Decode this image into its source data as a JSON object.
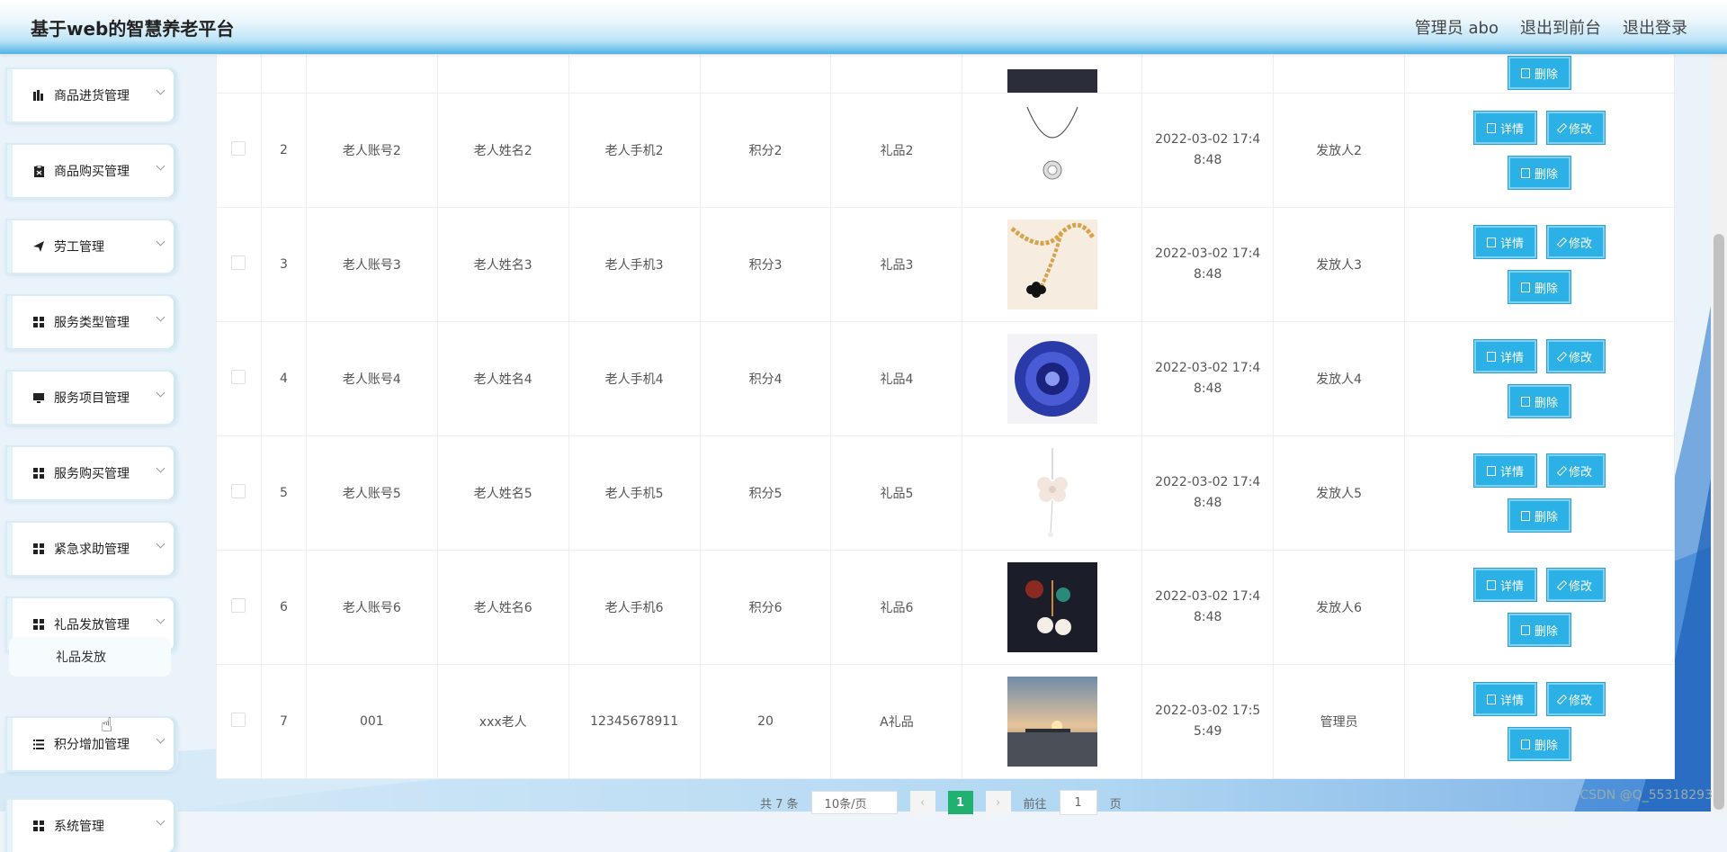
{
  "header": {
    "title": "基于web的智慧养老平台",
    "links": [
      "管理员 abo",
      "退出到前台",
      "退出登录"
    ]
  },
  "sidebar": {
    "items": [
      {
        "label": "商品进货管理",
        "icon": "bar-chart-icon"
      },
      {
        "label": "商品购买管理",
        "icon": "clipboard-icon"
      },
      {
        "label": "劳工管理",
        "icon": "send-icon"
      },
      {
        "label": "服务类型管理",
        "icon": "grid-icon"
      },
      {
        "label": "服务项目管理",
        "icon": "monitor-icon"
      },
      {
        "label": "服务购买管理",
        "icon": "grid-icon"
      },
      {
        "label": "紧急求助管理",
        "icon": "grid-icon"
      },
      {
        "label": "礼品发放管理",
        "icon": "grid-icon"
      },
      {
        "label": "积分增加管理",
        "icon": "list-icon"
      },
      {
        "label": "系统管理",
        "icon": "grid-icon"
      }
    ],
    "sub_item": "礼品发放"
  },
  "table": {
    "top_partial_button": "删除",
    "rows": [
      {
        "idx": "2",
        "account": "老人账号2",
        "name": "老人姓名2",
        "phone": "老人手机2",
        "points": "积分2",
        "gift": "礼品2",
        "image": "necklace-pendant",
        "time": "2022-03-02 17:48:48",
        "issuer": "发放人2"
      },
      {
        "idx": "3",
        "account": "老人账号3",
        "name": "老人姓名3",
        "phone": "老人手机3",
        "points": "积分3",
        "gift": "礼品3",
        "image": "gold-chain",
        "time": "2022-03-02 17:48:48",
        "issuer": "发放人3"
      },
      {
        "idx": "4",
        "account": "老人账号4",
        "name": "老人姓名4",
        "phone": "老人手机4",
        "points": "积分4",
        "gift": "礼品4",
        "image": "blue-brooch",
        "time": "2022-03-02 17:48:48",
        "issuer": "发放人4"
      },
      {
        "idx": "5",
        "account": "老人账号5",
        "name": "老人姓名5",
        "phone": "老人手机5",
        "points": "积分5",
        "gift": "礼品5",
        "image": "flower-pendant",
        "time": "2022-03-02 17:48:48",
        "issuer": "发放人5"
      },
      {
        "idx": "6",
        "account": "老人账号6",
        "name": "老人姓名6",
        "phone": "老人手机6",
        "points": "积分6",
        "gift": "礼品6",
        "image": "earring-set",
        "time": "2022-03-02 17:48:48",
        "issuer": "发放人6"
      },
      {
        "idx": "7",
        "account": "001",
        "name": "xxx老人",
        "phone": "12345678911",
        "points": "20",
        "gift": "A礼品",
        "image": "sunset-photo",
        "time": "2022-03-02 17:55:49",
        "issuer": "管理员"
      }
    ],
    "actions": {
      "detail": "详情",
      "edit": "修改",
      "delete": "删除"
    }
  },
  "pagination": {
    "total": "共 7 条",
    "page_size": "10条/页",
    "current": "1",
    "goto_label": "前往",
    "goto_value": "1",
    "page_suffix": "页"
  },
  "watermark": "CSDN @Q_55318293",
  "colors": {
    "accent": "#2cb1e6",
    "pager_active": "#20b070"
  }
}
